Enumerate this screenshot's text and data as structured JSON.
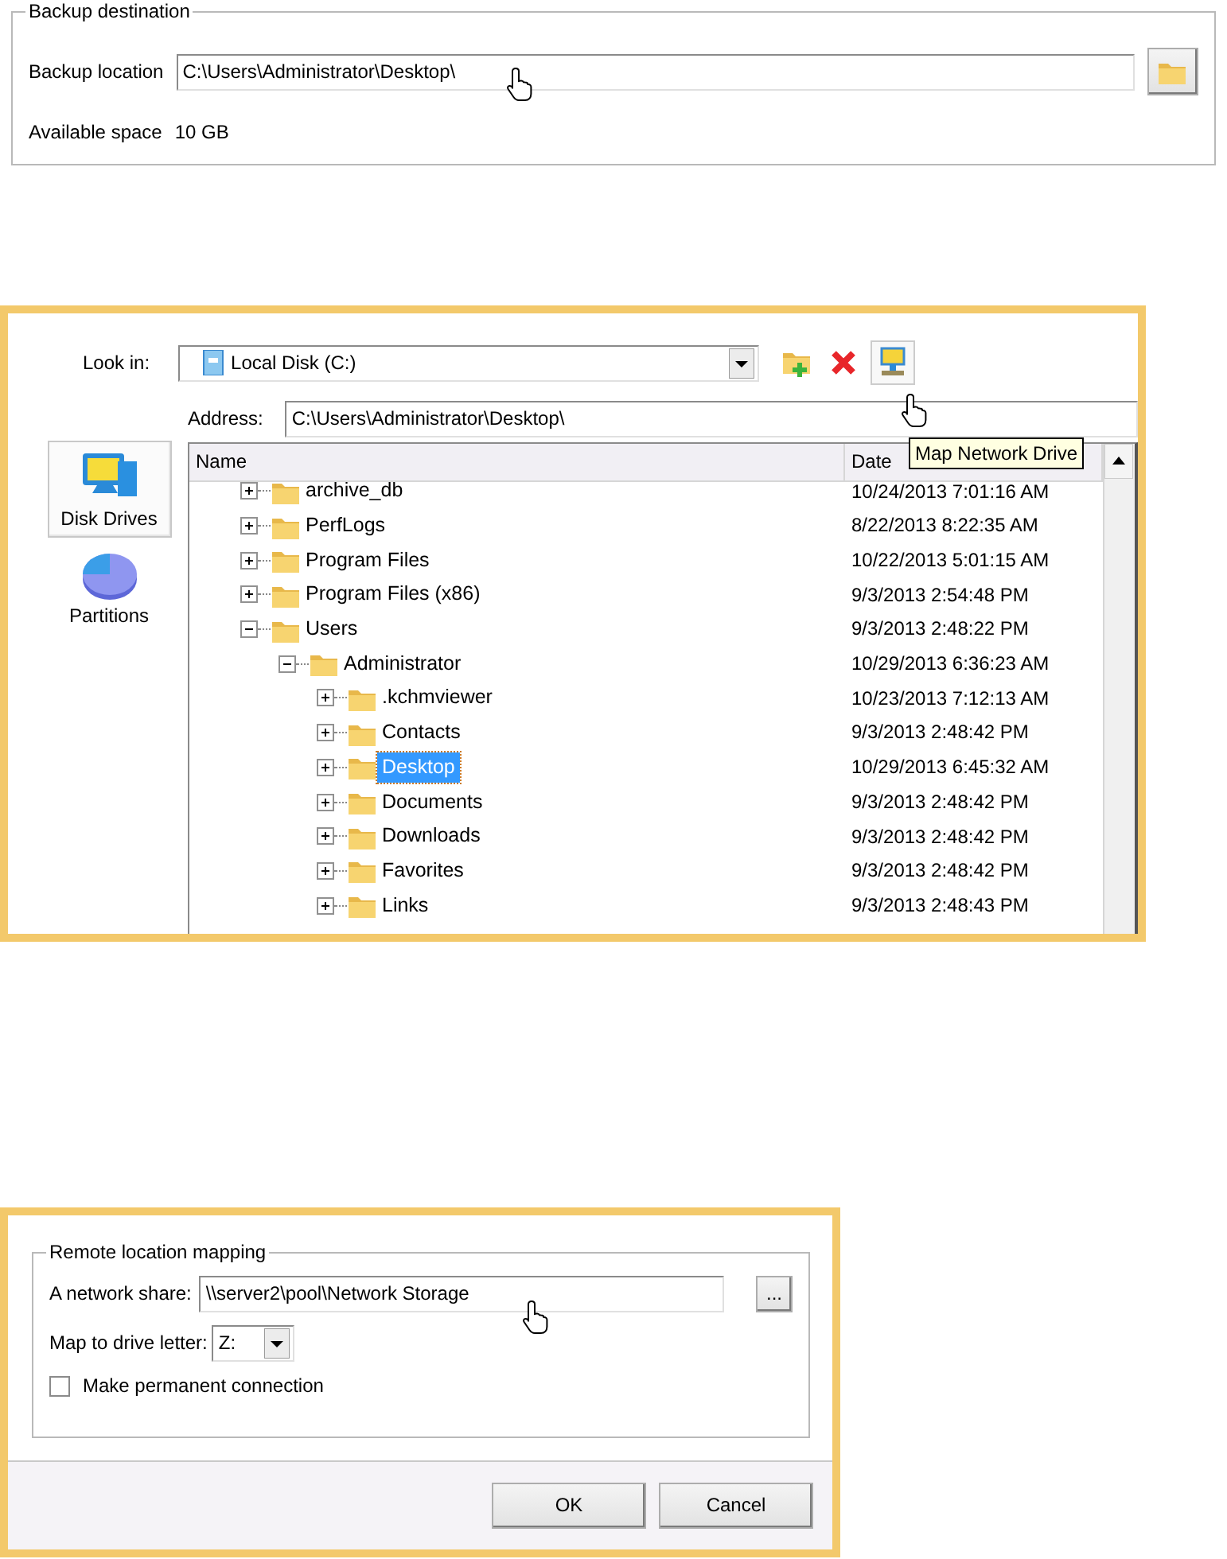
{
  "backup_destination": {
    "title": "Backup destination",
    "location_label": "Backup location",
    "location_value": "C:\\Users\\Administrator\\Desktop\\",
    "space_label": "Available space",
    "space_value": "10 GB"
  },
  "browse_dialog": {
    "look_in_label": "Look in:",
    "look_in_value": "Local Disk (C:)",
    "address_label": "Address:",
    "address_value": "C:\\Users\\Administrator\\Desktop\\",
    "tooltip": "Map Network Drive",
    "sidebar": [
      {
        "label": "Disk Drives",
        "kind": "drives",
        "selected": true
      },
      {
        "label": "Partitions",
        "kind": "partitions",
        "selected": false
      }
    ],
    "columns": [
      "Name",
      "Date"
    ],
    "tree": [
      {
        "name": "archive_db",
        "date": "10/24/2013 7:01:16 AM",
        "expanded": false,
        "selected": false
      },
      {
        "name": "PerfLogs",
        "date": "8/22/2013 8:22:35 AM",
        "expanded": false,
        "selected": false
      },
      {
        "name": "Program Files",
        "date": "10/22/2013 5:01:15 AM",
        "expanded": false,
        "selected": false
      },
      {
        "name": "Program Files (x86)",
        "date": "9/3/2013 2:54:48 PM",
        "expanded": false,
        "selected": false
      },
      {
        "name": "Users",
        "date": "9/3/2013 2:48:22 PM",
        "expanded": true,
        "selected": false,
        "children": [
          {
            "name": "Administrator",
            "date": "10/29/2013 6:36:23 AM",
            "expanded": true,
            "selected": false,
            "children": [
              {
                "name": ".kchmviewer",
                "date": "10/23/2013 7:12:13 AM",
                "expanded": false,
                "selected": false
              },
              {
                "name": "Contacts",
                "date": "9/3/2013 2:48:42 PM",
                "expanded": false,
                "selected": false
              },
              {
                "name": "Desktop",
                "date": "10/29/2013 6:45:32 AM",
                "expanded": false,
                "selected": true
              },
              {
                "name": "Documents",
                "date": "9/3/2013 2:48:42 PM",
                "expanded": false,
                "selected": false
              },
              {
                "name": "Downloads",
                "date": "9/3/2013 2:48:42 PM",
                "expanded": false,
                "selected": false
              },
              {
                "name": "Favorites",
                "date": "9/3/2013 2:48:42 PM",
                "expanded": false,
                "selected": false
              },
              {
                "name": "Links",
                "date": "9/3/2013 2:48:43 PM",
                "expanded": false,
                "selected": false
              }
            ]
          }
        ]
      }
    ]
  },
  "mapping_dialog": {
    "title": "Remote location mapping",
    "share_label": "A network share:",
    "share_value": "\\\\server2\\pool\\Network Storage",
    "browse_button": "...",
    "drive_label": "Map to drive letter:",
    "drive_value": "Z:",
    "permanent": {
      "label": "Make permanent connection",
      "checked": false
    },
    "buttons": [
      "OK",
      "Cancel"
    ]
  }
}
